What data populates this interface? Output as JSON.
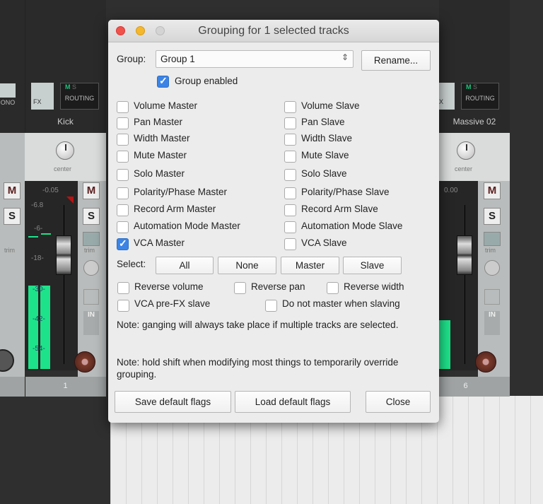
{
  "mixer": {
    "left_strip": {
      "label": "ONO"
    },
    "kick": {
      "name": "Kick",
      "fx": "FX",
      "routing": "ROUTING",
      "msr": [
        "M",
        "S"
      ],
      "pan": "center",
      "peak": "-0.05",
      "scale": [
        "-6.8",
        "-6-",
        "-18-",
        "-30-",
        "-42-",
        "-54-"
      ],
      "mute": "M",
      "solo": "S",
      "trim": "trim",
      "in": "IN",
      "number": "1"
    },
    "massive": {
      "name": "Massive 02",
      "fx": "X",
      "routing": "ROUTING",
      "msr": [
        "M",
        "S"
      ],
      "pan": "center",
      "peak": "0.00",
      "mute": "M",
      "solo": "S",
      "trim": "trim",
      "in": "IN",
      "number": "6"
    },
    "left": {
      "mute": "M",
      "solo": "S",
      "trim": "trim"
    },
    "meter_color": "#1ee28a"
  },
  "dialog": {
    "title": "Grouping for 1 selected tracks",
    "group_label": "Group:",
    "group_value": "Group 1",
    "rename": "Rename...",
    "group_enabled": {
      "label": "Group enabled",
      "checked": true
    },
    "masters": [
      {
        "label": "Volume Master",
        "checked": false
      },
      {
        "label": "Pan Master",
        "checked": false
      },
      {
        "label": "Width Master",
        "checked": false
      },
      {
        "label": "Mute Master",
        "checked": false
      },
      {
        "label": "Solo Master",
        "checked": false
      },
      {
        "label": "Polarity/Phase Master",
        "checked": false
      },
      {
        "label": "Record Arm Master",
        "checked": false
      },
      {
        "label": "Automation Mode Master",
        "checked": false
      },
      {
        "label": "VCA Master",
        "checked": true
      }
    ],
    "slaves": [
      {
        "label": "Volume Slave",
        "checked": false
      },
      {
        "label": "Pan Slave",
        "checked": false
      },
      {
        "label": "Width Slave",
        "checked": false
      },
      {
        "label": "Mute Slave",
        "checked": false
      },
      {
        "label": "Solo Slave",
        "checked": false
      },
      {
        "label": "Polarity/Phase Slave",
        "checked": false
      },
      {
        "label": "Record Arm Slave",
        "checked": false
      },
      {
        "label": "Automation Mode Slave",
        "checked": false
      },
      {
        "label": "VCA Slave",
        "checked": false
      }
    ],
    "select_label": "Select:",
    "select_buttons": [
      "All",
      "None",
      "Master",
      "Slave"
    ],
    "options": {
      "reverse_volume": "Reverse volume",
      "reverse_pan": "Reverse pan",
      "reverse_width": "Reverse width",
      "vca_prefx": "VCA pre-FX slave",
      "no_master": "Do not master when slaving"
    },
    "note1": "Note: ganging will always take place if multiple tracks are selected.",
    "note2": "Note: hold shift when modifying most things to temporarily override grouping.",
    "save": "Save default flags",
    "load": "Load default flags",
    "close": "Close"
  }
}
